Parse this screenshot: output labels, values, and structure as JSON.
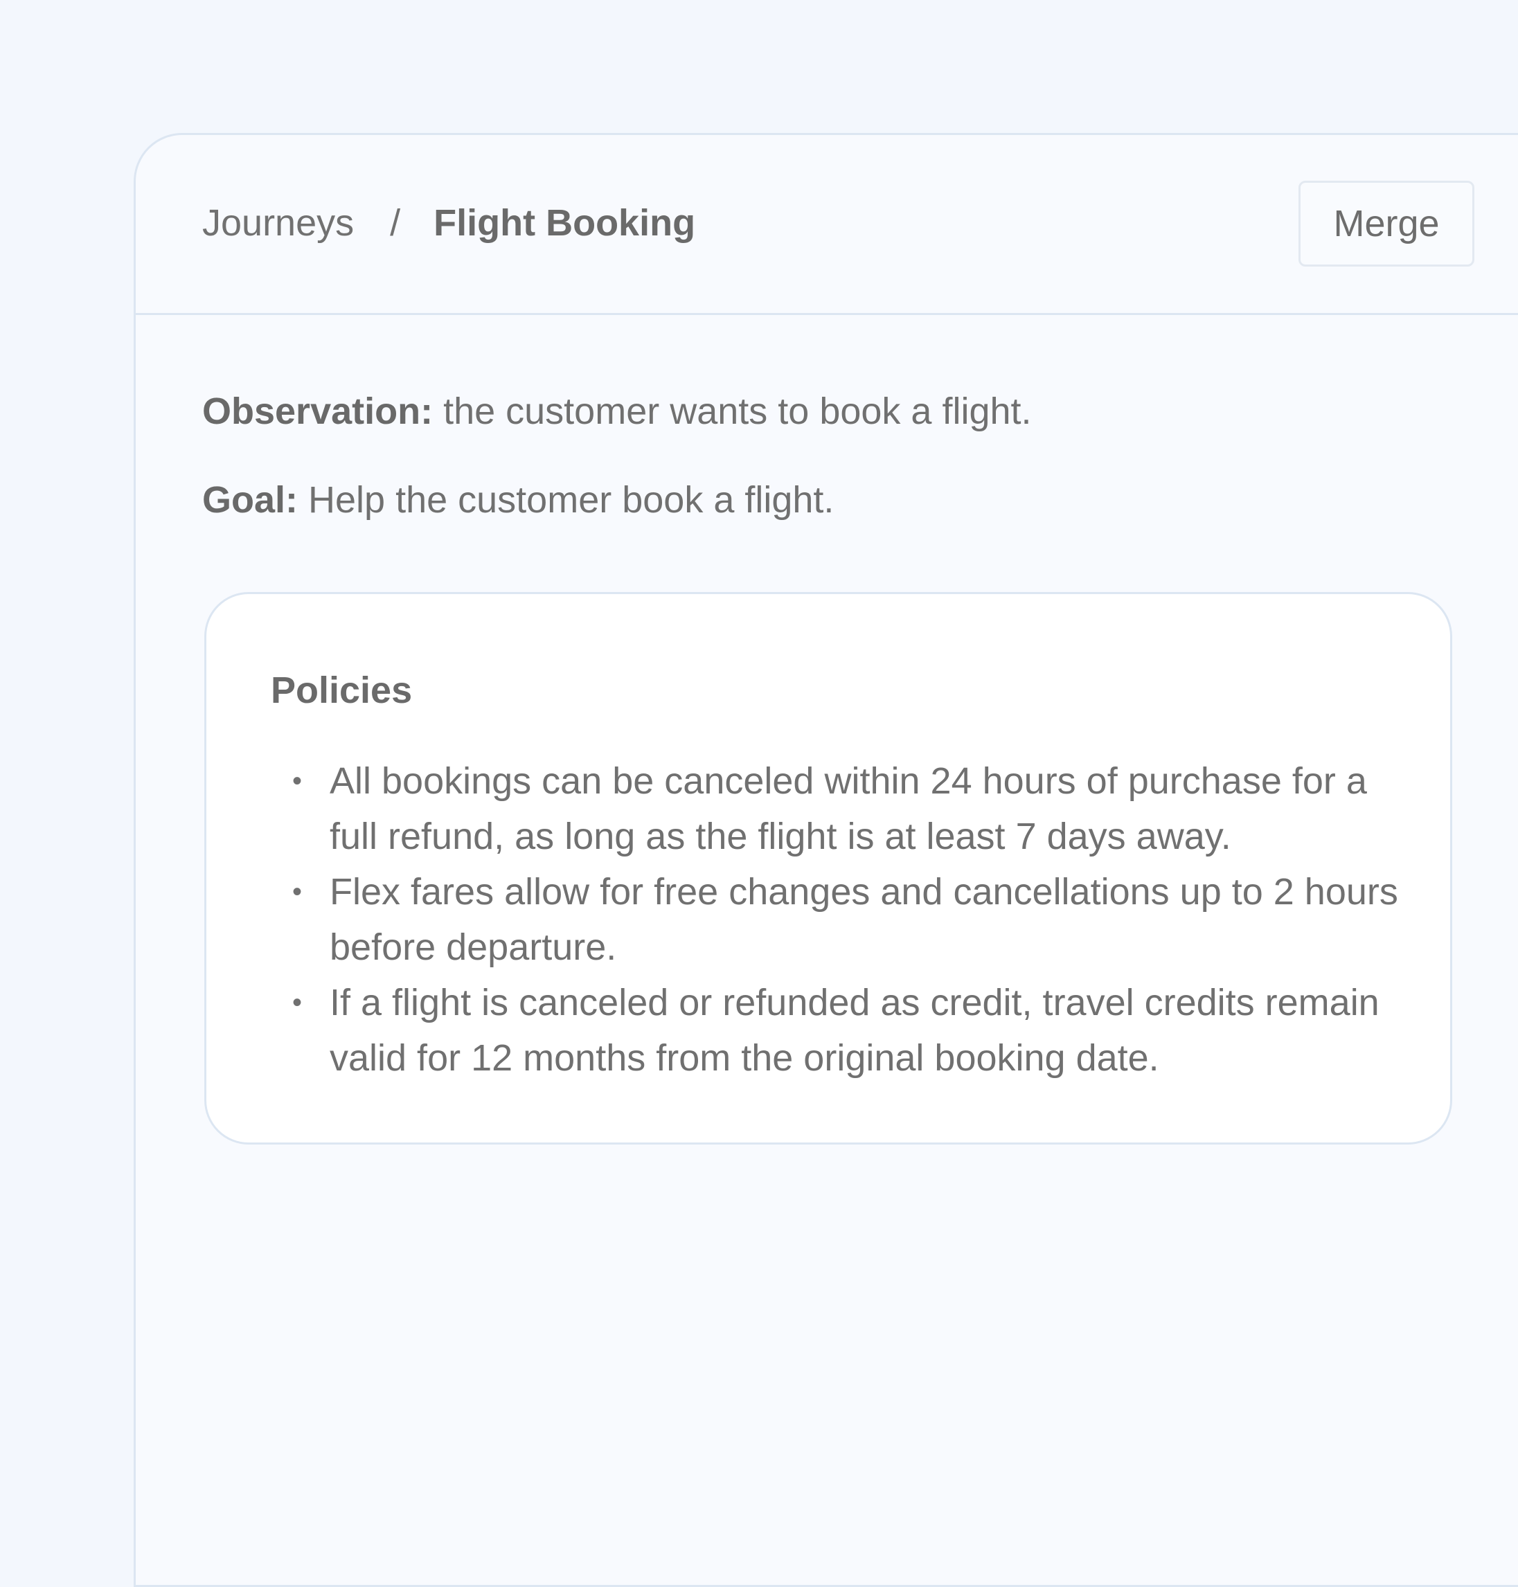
{
  "breadcrumb": {
    "root": "Journeys",
    "separator": "/",
    "current": "Flight Booking"
  },
  "actions": {
    "merge_label": "Merge"
  },
  "journey": {
    "observation_label": "Observation:",
    "observation_text": " the customer wants to book a flight.",
    "goal_label": "Goal:",
    "goal_text": " Help the customer book a flight."
  },
  "policies": {
    "title": "Policies",
    "bullet_glyph": "•",
    "items": [
      "All bookings can be canceled within 24 hours of purchase for a full refund, as long as the flight is at least 7 days away.",
      "Flex fares allow for free changes and cancellations up to 2 hours before departure.",
      "If a flight is canceled or refunded as credit, travel credits remain valid for 12 months from the original booking date."
    ]
  },
  "colors": {
    "background": "#f3f7fd",
    "panel": "#f8fafe",
    "card": "#ffffff",
    "border": "#dce6f2",
    "text": "#6b6b6b"
  }
}
